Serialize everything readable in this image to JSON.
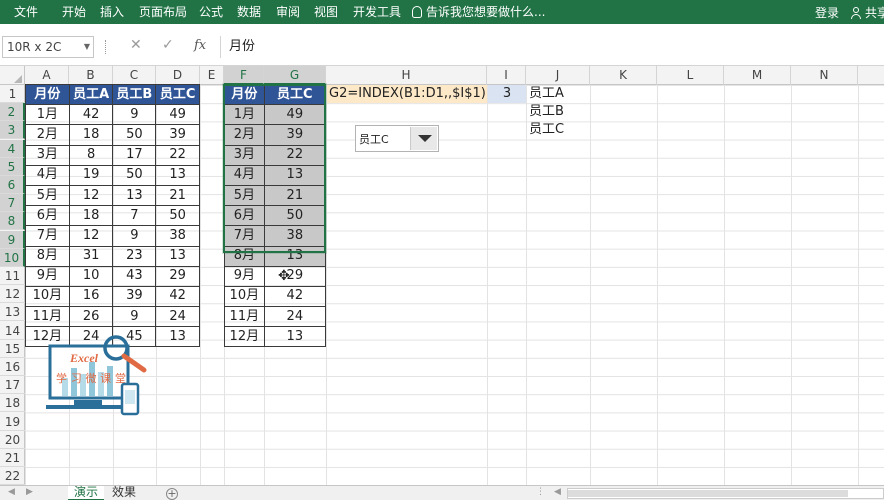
{
  "ribbon": {
    "tabs": [
      "文件",
      "开始",
      "插入",
      "页面布局",
      "公式",
      "数据",
      "审阅",
      "视图",
      "开发工具"
    ],
    "tell_me": "告诉我您想要做什么...",
    "login": "登录",
    "share": "共享",
    "bg_color": "#217346"
  },
  "formula_bar": {
    "name_box": "10R x 2C",
    "cancel_icon": "✕",
    "confirm_icon": "✓",
    "fx_label": "fx",
    "content": "月份"
  },
  "columns": [
    "A",
    "B",
    "C",
    "D",
    "E",
    "F",
    "G",
    "H",
    "I",
    "J",
    "K",
    "L",
    "M",
    "N"
  ],
  "rows": [
    "1",
    "2",
    "3",
    "4",
    "5",
    "6",
    "7",
    "8",
    "9",
    "10",
    "11",
    "12",
    "13",
    "14",
    "15",
    "16",
    "17",
    "18",
    "19",
    "20",
    "21",
    "22"
  ],
  "left_table": {
    "headers": [
      "月份",
      "员工A",
      "员工B",
      "员工C"
    ],
    "rows": [
      [
        "1月",
        "42",
        "9",
        "49"
      ],
      [
        "2月",
        "18",
        "50",
        "39"
      ],
      [
        "3月",
        "8",
        "17",
        "22"
      ],
      [
        "4月",
        "19",
        "50",
        "13"
      ],
      [
        "5月",
        "12",
        "13",
        "21"
      ],
      [
        "6月",
        "18",
        "7",
        "50"
      ],
      [
        "7月",
        "12",
        "9",
        "38"
      ],
      [
        "8月",
        "31",
        "23",
        "13"
      ],
      [
        "9月",
        "10",
        "43",
        "29"
      ],
      [
        "10月",
        "16",
        "39",
        "42"
      ],
      [
        "11月",
        "26",
        "9",
        "24"
      ],
      [
        "12月",
        "24",
        "45",
        "13"
      ]
    ]
  },
  "right_table": {
    "headers": [
      "月份",
      "员工C"
    ],
    "rows": [
      [
        "1月",
        "49"
      ],
      [
        "2月",
        "39"
      ],
      [
        "3月",
        "22"
      ],
      [
        "4月",
        "13"
      ],
      [
        "5月",
        "21"
      ],
      [
        "6月",
        "50"
      ],
      [
        "7月",
        "38"
      ],
      [
        "8月",
        "13"
      ],
      [
        "9月",
        "29"
      ],
      [
        "10月",
        "42"
      ],
      [
        "11月",
        "24"
      ],
      [
        "12月",
        "13"
      ]
    ]
  },
  "formula_note": "G2=INDEX(B1:D1,,$I$1)",
  "index_value": "3",
  "j_list": [
    "员工A",
    "员工B",
    "员工C"
  ],
  "combo": {
    "value": "员工C"
  },
  "logo": {
    "text_en": "Excel",
    "text_cn": "学习微课堂"
  },
  "sheets": [
    {
      "name": "演示",
      "active": true
    },
    {
      "name": "效果",
      "active": false
    }
  ],
  "colors": {
    "header_blue": "#2f5597",
    "selected_gray": "#c8c8c8",
    "formula_note_bg": "#fde9c8",
    "index_bg": "#d9e3f1"
  }
}
